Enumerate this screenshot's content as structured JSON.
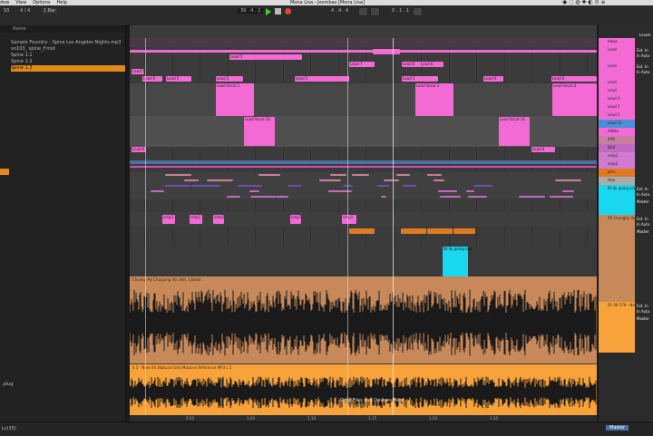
{
  "menu": {
    "items": [
      "dow",
      "View",
      "Options",
      "Help"
    ]
  },
  "window": {
    "title": "Mona Lisa - Joombas  [Mona Lisa]"
  },
  "toolbar": {
    "tempo": "93",
    "signature": "4 / 4",
    "bar_pos": "39 . 4 . 2",
    "loop_start": "4 . 4 . 4",
    "loop_len": "0 . 1 . 1",
    "zoom_sel": "1 Bar"
  },
  "browser": {
    "header": "Name",
    "items": [
      "Sample Foundry - Spine Los Angeles Nights.mp3",
      "vo103_ spine_F.mid",
      "Spine 1.1",
      "Spine 1.2",
      "Spine 1.3"
    ],
    "selected_index": 4
  },
  "ruler": {
    "bars": [
      "26",
      "27",
      "28",
      "29",
      "30",
      "31",
      "32",
      "33",
      "34",
      "35",
      "36",
      "37",
      "38",
      "39",
      "40",
      "41",
      "42"
    ],
    "markers": [
      "16",
      "3"
    ]
  },
  "clips": {
    "top_pink": [
      "Lead 7",
      "Lead 6",
      "Lead 5",
      "Lead 6",
      "Lead 5",
      "Lead 5",
      "Lead 5",
      "Lead 5",
      "Lead 6",
      "Lead 6",
      "Lead 6",
      "Lead 5",
      "Lead 10",
      "Lead 50",
      "Lead 5",
      "Lead 5"
    ],
    "vocal_tags": [
      "Lead Vocal 1",
      "Lead Vocal 3",
      "Lead Vocal 4",
      "Lead Vocal 16"
    ],
    "vocal_rows": [
      "Lead 6",
      "Lead 6"
    ],
    "small_pink": [
      "vmp1",
      "vmp1",
      "vmp1",
      "vmp1",
      "vmp1"
    ],
    "blue_clip": "Bt Ay going lalo",
    "audio1": "Chunky My Chopping Vol. Bet. 13beat",
    "audio2": "4 5 - Note lift (Natural Get) Massive Reference MP3 L 5"
  },
  "mixer": {
    "tracks": [
      {
        "name": "Ideas",
        "color": "#f36ad5"
      },
      {
        "name": "Lead",
        "color": "#f36ad5"
      },
      {
        "name": "Lead",
        "color": "#f36ad5"
      },
      {
        "name": "Lead",
        "color": "#f36ad5"
      },
      {
        "name": "Lead",
        "color": "#f36ad5"
      },
      {
        "name": "Lead 4",
        "color": "#f36ad5"
      },
      {
        "name": "Lead 5",
        "color": "#f36ad5"
      },
      {
        "name": "Lead 5",
        "color": "#f36ad5"
      },
      {
        "name": "Lead 11",
        "color": "#4a90d9"
      },
      {
        "name": "Adlibs",
        "color": "#f36ad5"
      },
      {
        "name": "SYN",
        "color": "#c87fa0"
      },
      {
        "name": "BGV",
        "color": "#c06ac0"
      },
      {
        "name": "vmp1",
        "color": "#d07ad0"
      },
      {
        "name": "vmp2",
        "color": "#d07ad0"
      },
      {
        "name": "perc",
        "color": "#e07a20"
      },
      {
        "name": "tmp",
        "color": "#aaaaaa"
      },
      {
        "name": "Bt Ay going lalo",
        "color": "#1ad7f0"
      },
      {
        "name": "09 Chunghy Vol",
        "color": "#c8895a"
      },
      {
        "name": "01 09 579 - Note",
        "color": "#f7a23a"
      }
    ],
    "labels": {
      "levels": "Levels",
      "ext_in": "Ext. In",
      "auto": "In  Auto",
      "master": "Master",
      "ext_out": "Ext. Out",
      "io": "1/2"
    }
  },
  "drop_hint": "Drop Files and Devices Here",
  "timeline_bottom": [
    "0:50",
    "1:00",
    "1:10",
    "1:15",
    "1:20",
    "1:30"
  ],
  "status": {
    "left": "Lc(15)",
    "right": "Master"
  },
  "colors": {
    "pink": "#f36ad5",
    "blue": "#1ad7f0",
    "brown": "#c8895a",
    "orange": "#f7a23a"
  }
}
